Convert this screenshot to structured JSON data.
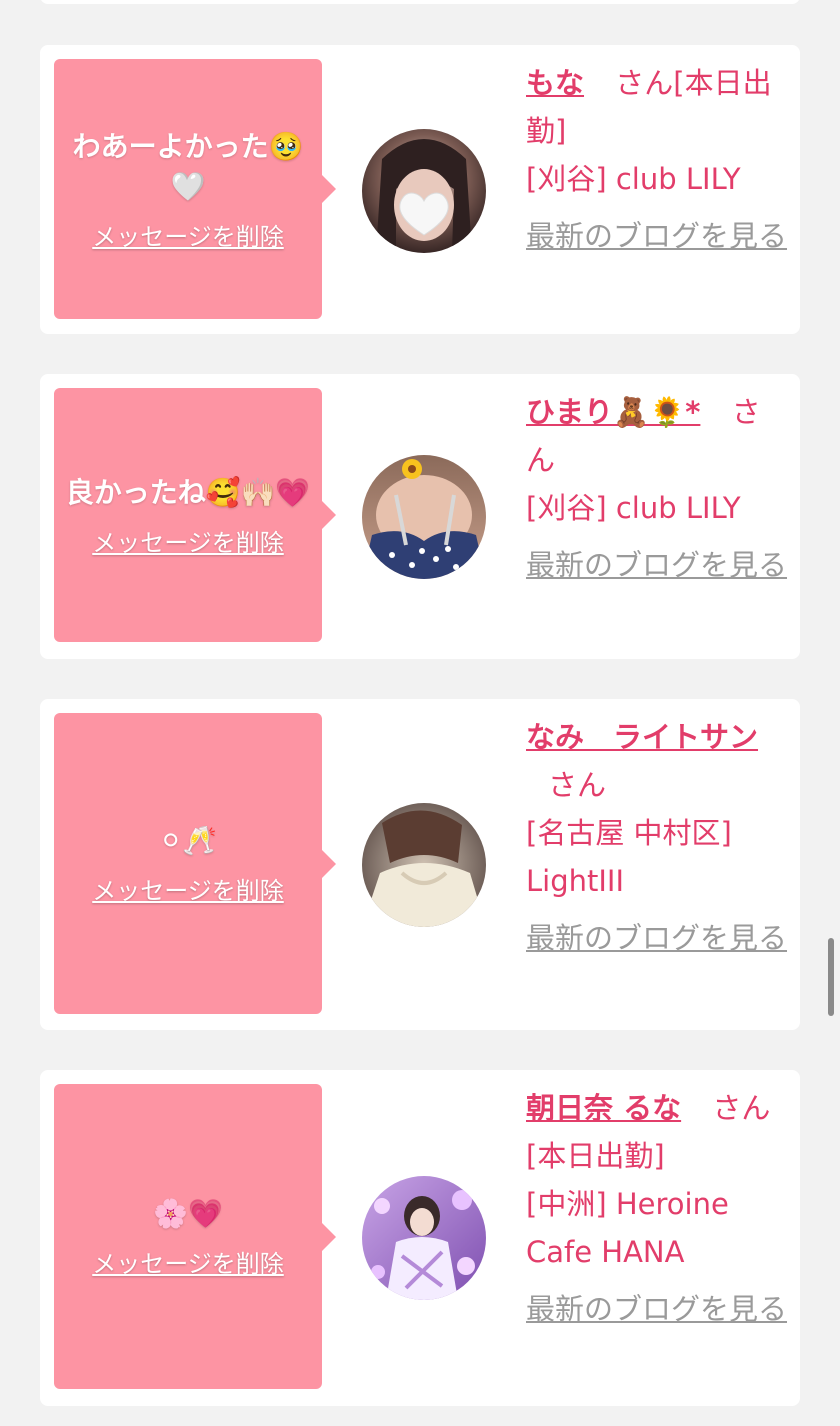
{
  "delete_label": "メッセージを削除",
  "blog_label": "最新のブログを見る",
  "colors": {
    "bubble": "#fd94a3",
    "accent": "#e23d6a",
    "link_gray": "#9a9a9a",
    "background": "#f2f2f2"
  },
  "cards": [
    {
      "message": "わあーよかった🥹🤍",
      "name": "もな",
      "san": "さん",
      "status": "[本日出勤]",
      "shop": "[刈谷] club LILY"
    },
    {
      "message": "良かったね🥰🙌🏻💗",
      "name": "ひまり🧸🌻*",
      "san": "さん",
      "status": "",
      "shop": "[刈谷] club LILY"
    },
    {
      "message": "⚪︎🥂",
      "name": "なみ　ライトサン",
      "san": "さん",
      "status": "",
      "shop": "[名古屋 中村区] LightIII"
    },
    {
      "message": "🌸💗",
      "name": "朝日奈 るな",
      "san": "さん",
      "status": "[本日出勤]",
      "shop": "[中洲] Heroine Cafe HANA"
    }
  ]
}
